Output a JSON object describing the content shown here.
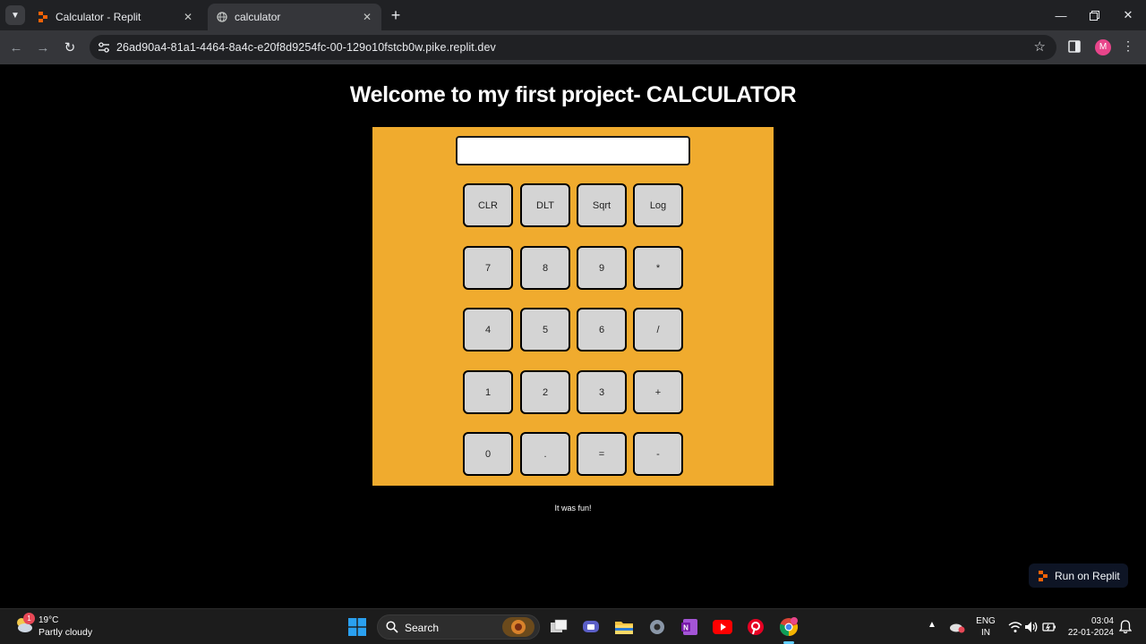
{
  "browser": {
    "tabs": [
      {
        "title": "Calculator - Replit",
        "active": false,
        "favicon": "replit-icon"
      },
      {
        "title": "calculator",
        "active": true,
        "favicon": "globe-icon"
      }
    ],
    "url": "26ad90a4-81a1-4464-8a4c-e20f8d9254fc-00-129o10fstcb0w.pike.replit.dev",
    "profile_initial": "M"
  },
  "page": {
    "heading": "Welcome to my first project- CALCULATOR",
    "display_value": "",
    "keys": [
      [
        "CLR",
        "DLT",
        "Sqrt",
        "Log"
      ],
      [
        "7",
        "8",
        "9",
        "*"
      ],
      [
        "4",
        "5",
        "6",
        "/"
      ],
      [
        "1",
        "2",
        "3",
        "+"
      ],
      [
        "0",
        ".",
        "=",
        "-"
      ]
    ],
    "footer": "It was fun!",
    "run_button": "Run on Replit"
  },
  "colors": {
    "calculator_bg": "#f0ab2e",
    "key_bg": "#d4d4d4",
    "page_bg": "#000000"
  },
  "taskbar": {
    "weather_temp": "19°C",
    "weather_desc": "Partly cloudy",
    "weather_badge": "1",
    "search_label": "Search",
    "lang_line1": "ENG",
    "lang_line2": "IN",
    "time": "03:04",
    "date": "22-01-2024"
  }
}
